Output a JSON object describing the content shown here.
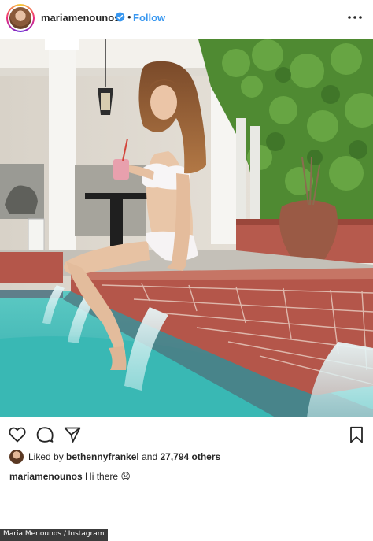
{
  "post": {
    "username": "mariamenounos",
    "follow_label": "Follow",
    "dot_separator": "•"
  },
  "likes": {
    "prefix": "Liked by",
    "liker": "bethennyfrankel",
    "connector": "and",
    "others": "27,794 others"
  },
  "caption": {
    "username": "mariamenounos",
    "text": "Hi there 😧"
  },
  "credit": "Maria Menounos / Instagram",
  "icons": {
    "verified": "verified-badge-icon",
    "more": "more-options-icon",
    "like": "heart-icon",
    "comment": "comment-icon",
    "share": "share-icon",
    "save": "bookmark-icon"
  },
  "colors": {
    "follow": "#3897f0",
    "verified": "#3897f0",
    "pool": "#3fb9b6",
    "brick": "#b4564a"
  }
}
